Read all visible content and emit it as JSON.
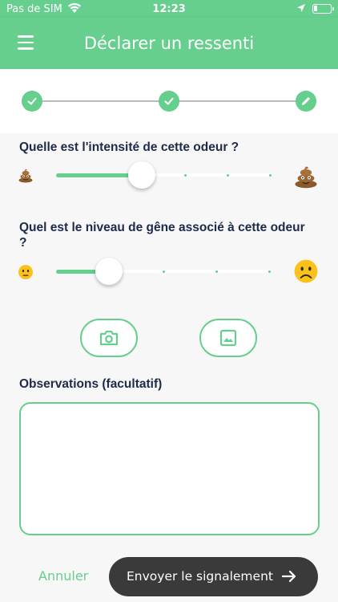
{
  "status_bar": {
    "carrier": "Pas de SIM",
    "time": "12:23",
    "icons": [
      "wifi-icon",
      "location-arrow-icon",
      "battery-icon"
    ]
  },
  "header": {
    "title": "Déclarer un ressenti",
    "menu_icon": "menu-icon",
    "background_color": "#66cf8e"
  },
  "stepper": {
    "steps": [
      {
        "state": "done",
        "icon": "check-icon"
      },
      {
        "state": "done",
        "icon": "check-icon"
      },
      {
        "state": "current",
        "icon": "pencil-icon"
      }
    ]
  },
  "form": {
    "intensity": {
      "question": "Quelle est l'intensité de cette odeur ?",
      "min_icon": "poop-emoji-small",
      "max_icon": "poop-emoji-large",
      "level": 2,
      "levels": 6
    },
    "annoyance": {
      "question": "Quel est le niveau de gêne associé à cette odeur ?",
      "min_icon": "neutral-face-emoji",
      "max_icon": "frowning-face-emoji",
      "level": 1,
      "levels": 5
    },
    "media": {
      "camera_icon": "camera-icon",
      "gallery_icon": "image-icon"
    },
    "observations": {
      "label": "Observations (facultatif)",
      "value": "",
      "placeholder": ""
    }
  },
  "actions": {
    "cancel_label": "Annuler",
    "submit_label": "Envoyer le signalement",
    "submit_icon": "arrow-right-icon"
  },
  "colors": {
    "accent": "#66cf8e",
    "text": "#1e2a4a",
    "submit_bg": "#3a3a3a"
  }
}
